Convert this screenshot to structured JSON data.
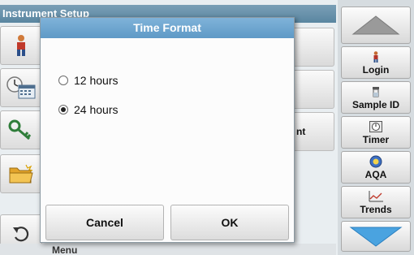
{
  "background_page": {
    "title": "Instrument Setup",
    "partial_button_text": "nt",
    "bottom_strip_text": "Menu"
  },
  "left_icons": [
    {
      "icon": "operator-icon"
    },
    {
      "icon": "clock-calendar-icon"
    },
    {
      "icon": "key-icon"
    },
    {
      "icon": "folder-icon"
    },
    {
      "icon": "back-arrow-icon"
    }
  ],
  "sidebar": {
    "up_icon": "scroll-up-arrow-icon",
    "down_icon": "scroll-down-arrow-icon",
    "buttons": [
      {
        "label": "Login",
        "icon": "person-icon"
      },
      {
        "label": "Sample ID",
        "icon": "sample-vial-icon"
      },
      {
        "label": "Timer",
        "icon": "timer-icon"
      },
      {
        "label": "AQA",
        "icon": "aqa-icon"
      },
      {
        "label": "Trends",
        "icon": "trends-chart-icon"
      }
    ]
  },
  "dialog": {
    "title": "Time Format",
    "options": [
      {
        "label": "12 hours",
        "selected": false
      },
      {
        "label": "24 hours",
        "selected": true
      }
    ],
    "cancel_label": "Cancel",
    "ok_label": "OK"
  },
  "colors": {
    "dialog_title_bar": "#6ea8d0",
    "page_title_bar": "#6a93ac",
    "sidebar_arrow": "#4aa3e0"
  }
}
